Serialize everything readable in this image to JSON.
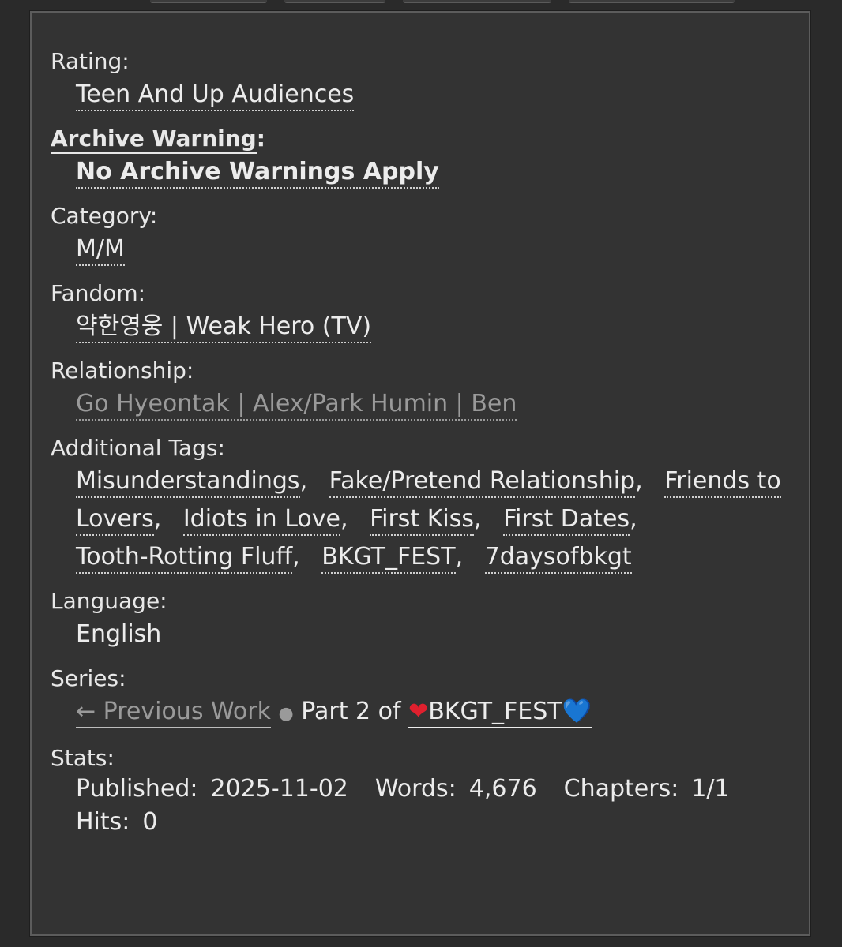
{
  "meta": {
    "rating_label": "Rating:",
    "rating_value": "Teen And Up Audiences",
    "warning_label": "Archive Warning",
    "warning_colon": ":",
    "warning_value": "No Archive Warnings Apply",
    "category_label": "Category:",
    "category_value": "M/M",
    "fandom_label": "Fandom:",
    "fandom_value": "약한영웅 | Weak Hero (TV)",
    "relationship_label": "Relationship:",
    "relationship_value": "Go Hyeontak | Alex/Park Humin | Ben",
    "tags_label": "Additional Tags:",
    "tags": [
      "Misunderstandings",
      "Fake/Pretend Relationship",
      "Friends to Lovers",
      "Idiots in Love",
      "First Kiss",
      "First Dates",
      "Tooth-Rotting Fluff",
      "BKGT_FEST",
      "7daysofbkgt"
    ],
    "language_label": "Language:",
    "language_value": "English",
    "series_label": "Series:",
    "series_prev": "← Previous Work",
    "series_bullet": "●",
    "series_part": "Part 2 of",
    "series_name": "BKGT_FEST",
    "series_heart_red": "❤",
    "series_heart_blue": "💙",
    "stats_label": "Stats:",
    "stats": {
      "published_label": "Published:",
      "published_value": "2025-11-02",
      "words_label": "Words:",
      "words_value": "4,676",
      "chapters_label": "Chapters:",
      "chapters_value": "1/1",
      "hits_label": "Hits:",
      "hits_value": "0"
    }
  }
}
